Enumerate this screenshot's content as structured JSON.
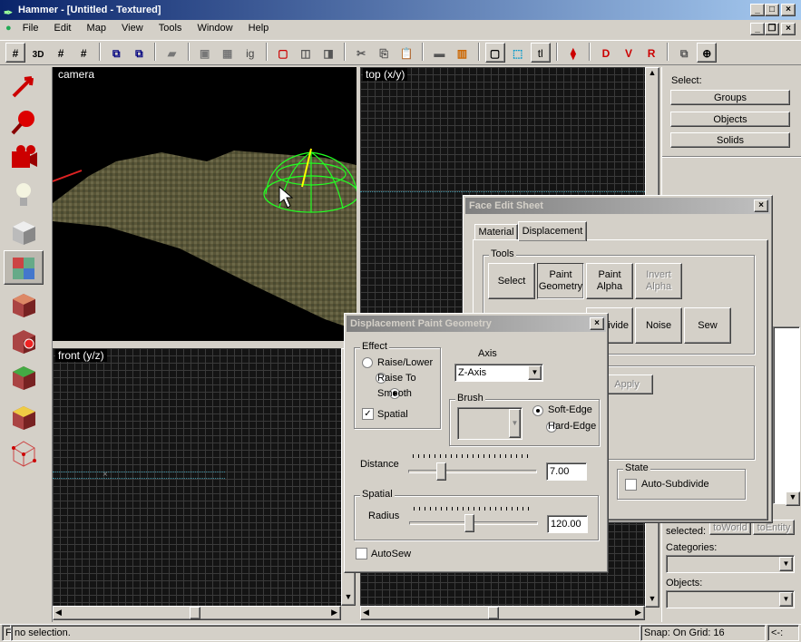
{
  "window": {
    "title": "Hammer - [Untitled - Textured]"
  },
  "menu": [
    "File",
    "Edit",
    "Map",
    "View",
    "Tools",
    "Window",
    "Help"
  ],
  "toolbar": {
    "icons": [
      "grid-icon",
      "3d-grid-icon",
      "grid-smaller-icon",
      "grid-larger-icon",
      "group-icon",
      "ungroup-icon",
      "hide-icon",
      "toggle-group-icon",
      "ignore-group-icon",
      "ig",
      "carve-icon",
      "make-hollow-icon",
      "cordon-icon",
      "cut-icon",
      "copy-icon",
      "paste-icon",
      "texture-lock-icon",
      "texture-app-icon",
      "select-icon",
      "translate-icon",
      "tl",
      "flip-icon",
      "run-icon",
      "box-icon",
      "sphere-icon"
    ]
  },
  "tools_panel": {
    "icons": [
      "selection-tool-icon",
      "magnify-tool-icon",
      "camera-tool-icon",
      "entity-tool-icon",
      "block-tool-icon",
      "texture-application-icon",
      "apply-decals-icon",
      "overlay-icon",
      "clipping-tool-icon",
      "vertex-tool-icon",
      "path-tool-icon"
    ]
  },
  "viewports": {
    "camera": "camera",
    "top": "top (x/y)",
    "front": "front (y/z)"
  },
  "select_panel": {
    "label": "Select:",
    "buttons": [
      "Groups",
      "Objects",
      "Solids"
    ]
  },
  "right_lower": {
    "selected_label": "selected:",
    "to_world": "toWorld",
    "to_entity": "toEntity",
    "categories_label": "Categories:",
    "objects_label": "Objects:"
  },
  "face_edit": {
    "title": "Face Edit Sheet",
    "tabs": [
      "Material",
      "Displacement"
    ],
    "tools_label": "Tools",
    "tools_row1": [
      "Select",
      "Paint\nGeometry",
      "Paint\nAlpha",
      "Invert\nAlpha"
    ],
    "tools_row2": [
      "ivide",
      "Noise",
      "Sew"
    ],
    "apply": "Apply",
    "state_label": "State",
    "auto_subdivide": "Auto-Subdivide"
  },
  "paint_geometry": {
    "title": "Displacement Paint Geometry",
    "effect_label": "Effect",
    "effects": [
      "Raise/Lower",
      "Raise To",
      "Smooth"
    ],
    "selected_effect": "Smooth",
    "spatial": "Spatial",
    "spatial_checked": true,
    "axis_label": "Axis",
    "axis_value": "Z-Axis",
    "brush_label": "Brush",
    "brush_options": [
      "Soft-Edge",
      "Hard-Edge"
    ],
    "selected_brush": "Soft-Edge",
    "distance_label": "Distance",
    "distance_value": "7.00",
    "spatial_group_label": "Spatial",
    "radius_label": "Radius",
    "radius_value": "120.00",
    "autosew": "AutoSew",
    "autosew_checked": false
  },
  "status": {
    "help": "F",
    "message": "no selection.",
    "snap": "Snap: On Grid: 16",
    "nav": "<-:"
  }
}
